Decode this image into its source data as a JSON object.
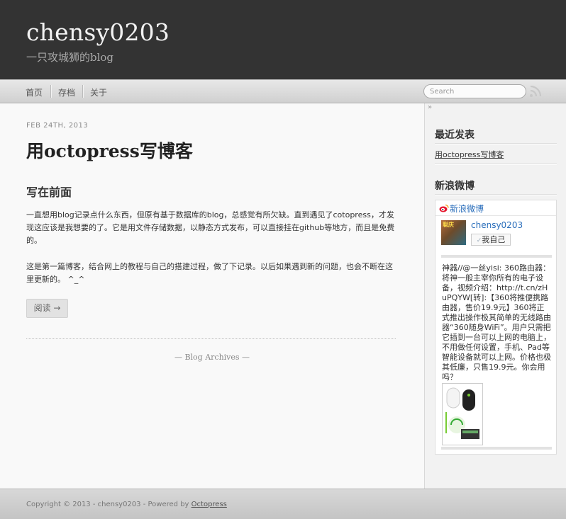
{
  "header": {
    "title": "chensy0203",
    "subtitle": "一只攻城狮的blog"
  },
  "nav": {
    "items": [
      {
        "label": "首页"
      },
      {
        "label": "存档"
      },
      {
        "label": "关于"
      }
    ],
    "search_placeholder": "Search"
  },
  "post": {
    "date": "FEB 24TH, 2013",
    "title": "用octopress写博客",
    "heading": "写在前面",
    "paragraphs": [
      "一直想用blog记录点什么东西，但原有基于数据库的blog，总感觉有所欠缺。直到遇见了cotopress，才发现这应该是我想要的了。它是用文件存储数据，以静态方式发布，可以直接挂在github等地方，而且是免费的。",
      "这是第一篇博客，结合网上的教程与自己的搭建过程，做了下记录。以后如果遇到新的问题，也会不断在这里更新的。 ^_^"
    ],
    "read_more": "阅读 →",
    "archives_link": "— Blog Archives —"
  },
  "sidebar": {
    "collapse_glyph": "»",
    "recent_heading": "最近发表",
    "recent_posts": [
      {
        "label": "用octopress写博客"
      }
    ],
    "weibo_heading": "新浪微博",
    "weibo": {
      "link_label": "新浪微博",
      "user_name": "chensy0203",
      "avatar_text": "聪庆",
      "follow_check": "✓",
      "follow_label": "我自己",
      "status_text": "神器//@一丝yisi: 360路由器：将神一般主宰你所有的电子设备，视频介绍：http://t.cn/zHuPQYW[转]:【360将推便携路由器，售价19.9元】360将正式推出操作极其简单的无线路由器“360随身WiFi”。用户只需把它插到一台可以上网的电脑上，不用做任何设置，手机、Pad等智能设备就可以上网。价格也极其低廉，只售19.9元。你会用吗？"
    }
  },
  "footer": {
    "prefix": "Copyright © 2013 - chensy0203 - Powered by ",
    "link_label": "Octopress"
  },
  "colors": {
    "header_bg": "#333333",
    "link_blue": "#2a6ebb",
    "weibo_red": "#e6162d",
    "rss_gray": "#c8c8c8"
  }
}
